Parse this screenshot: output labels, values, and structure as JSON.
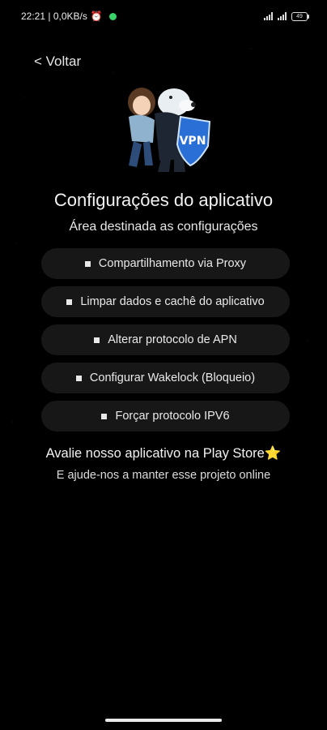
{
  "status_bar": {
    "time_speed": "22:21 | 0,0KB/s",
    "battery": "49"
  },
  "nav": {
    "back_label": "< Voltar"
  },
  "page": {
    "title": "Configurações do aplicativo",
    "subtitle": "Área destinada as configurações",
    "logo_text": "VPN"
  },
  "menu": {
    "items": [
      {
        "label": "Compartilhamento via Proxy"
      },
      {
        "label": "Limpar dados e cachê do aplicativo"
      },
      {
        "label": "Alterar protocolo de APN"
      },
      {
        "label": "Configurar Wakelock (Bloqueio)"
      },
      {
        "label": "Forçar protocolo IPV6"
      }
    ]
  },
  "footer": {
    "rate_text": "Avalie nosso aplicativo na Play Store",
    "rate_star": "⭐",
    "support_text": "E ajude-nos a manter esse projeto online"
  },
  "colors": {
    "background": "#000000",
    "button_bg": "#171717",
    "accent_green": "#3ad36a",
    "star": "#f7c21a"
  }
}
